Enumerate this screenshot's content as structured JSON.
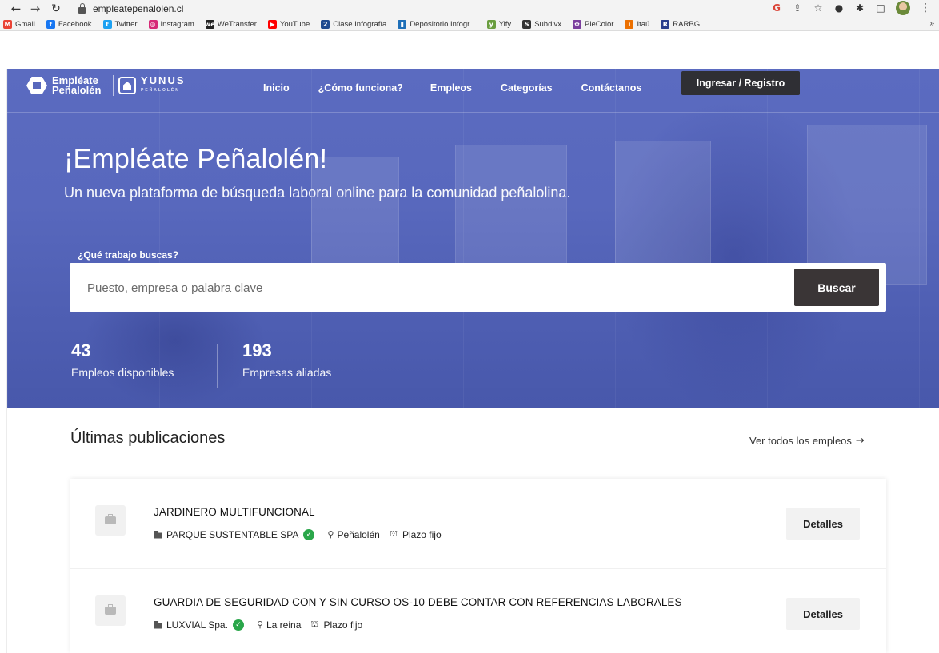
{
  "browser": {
    "url": "empleatepenalolen.cl",
    "bookmarks": [
      {
        "label": "Gmail",
        "icon": "gmail-icon",
        "glyph": "M",
        "color": "#ea4335"
      },
      {
        "label": "Facebook",
        "icon": "facebook-icon",
        "glyph": "f",
        "color": "#1877f2"
      },
      {
        "label": "Twitter",
        "icon": "twitter-icon",
        "glyph": "t",
        "color": "#1da1f2"
      },
      {
        "label": "Instagram",
        "icon": "instagram-icon",
        "glyph": "◎",
        "color": "#d62976"
      },
      {
        "label": "WeTransfer",
        "icon": "wetransfer-icon",
        "glyph": "we",
        "color": "#222222"
      },
      {
        "label": "YouTube",
        "icon": "youtube-icon",
        "glyph": "▶",
        "color": "#ff0000"
      },
      {
        "label": "Clase Infografía",
        "icon": "clase-infografia-icon",
        "glyph": "2",
        "color": "#1f4a8f"
      },
      {
        "label": "Depositorio Infogr...",
        "icon": "depositorio-icon",
        "glyph": "▮",
        "color": "#1e6fb8"
      },
      {
        "label": "Yify",
        "icon": "yify-icon",
        "glyph": "y",
        "color": "#6a9e3f"
      },
      {
        "label": "Subdivx",
        "icon": "subdivx-icon",
        "glyph": "S",
        "color": "#333333"
      },
      {
        "label": "PieColor",
        "icon": "piecolor-icon",
        "glyph": "✿",
        "color": "#7a3e9d"
      },
      {
        "label": "Itaú",
        "icon": "itau-icon",
        "glyph": "i",
        "color": "#ec7000"
      },
      {
        "label": "RARBG",
        "icon": "rarbg-icon",
        "glyph": "R",
        "color": "#2a3e8c"
      }
    ],
    "bookmarks_more": "»"
  },
  "brand": {
    "name_line1": "Empléate",
    "name_line2": "Peñalolén",
    "partner": "YUNUS",
    "partner_sub": "PEÑALOLÉN"
  },
  "nav": {
    "items": [
      "Inicio",
      "¿Cómo funciona?",
      "Empleos",
      "Categorías",
      "Contáctanos"
    ],
    "login": "Ingresar / Registro"
  },
  "hero": {
    "title": "¡Empléate Peñalolén!",
    "subtitle": "Un nueva plataforma de búsqueda laboral online para la comunidad peñalolina.",
    "search_label": "¿Qué trabajo buscas?",
    "search_placeholder": "Puesto, empresa o palabra clave",
    "search_button": "Buscar",
    "stats": [
      {
        "value": "43",
        "label": "Empleos disponibles"
      },
      {
        "value": "193",
        "label": "Empresas aliadas"
      }
    ]
  },
  "latest": {
    "title": "Últimas publicaciones",
    "see_all": "Ver todos los empleos",
    "jobs": [
      {
        "title": "JARDINERO MULTIFUNCIONAL",
        "company": "PARQUE SUSTENTABLE SPA",
        "location": "Peñalolén",
        "contract": "Plazo fijo",
        "button": "Detalles"
      },
      {
        "title": "GUARDIA DE SEGURIDAD CON Y SIN CURSO OS-10 DEBE CONTAR CON REFERENCIAS LABORALES",
        "company": "LUXVIAL Spa.",
        "location": "La reina",
        "contract": "Plazo fijo",
        "button": "Detalles"
      }
    ]
  }
}
